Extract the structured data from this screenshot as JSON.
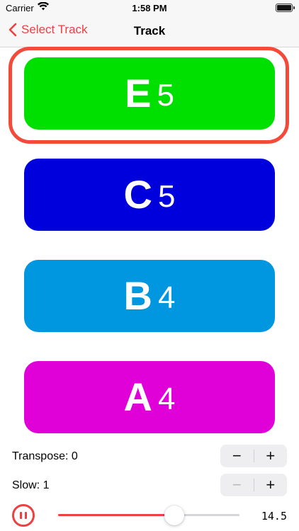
{
  "status_bar": {
    "carrier": "Carrier",
    "time": "1:58 PM",
    "wifi_icon": "wifi-icon",
    "battery_icon": "battery-icon"
  },
  "nav": {
    "back_label": "Select Track",
    "title": "Track",
    "back_icon": "chevron-left-icon"
  },
  "notes": [
    {
      "letter": "E",
      "octave": "5",
      "color": "#00e000"
    },
    {
      "letter": "C",
      "octave": "5",
      "color": "#0000dd"
    },
    {
      "letter": "B",
      "octave": "4",
      "color": "#0096e0"
    },
    {
      "letter": "A",
      "octave": "4",
      "color": "#e000d8"
    }
  ],
  "controls": {
    "transpose_label": "Transpose: 0",
    "slow_label": "Slow: 1",
    "minus_symbol": "−",
    "plus_symbol": "+"
  },
  "playback": {
    "pause_icon": "pause-icon",
    "slider_progress": 0.64,
    "value": "14.5"
  },
  "colors": {
    "accent": "#ee4040",
    "highlight": "#f44a3a"
  }
}
